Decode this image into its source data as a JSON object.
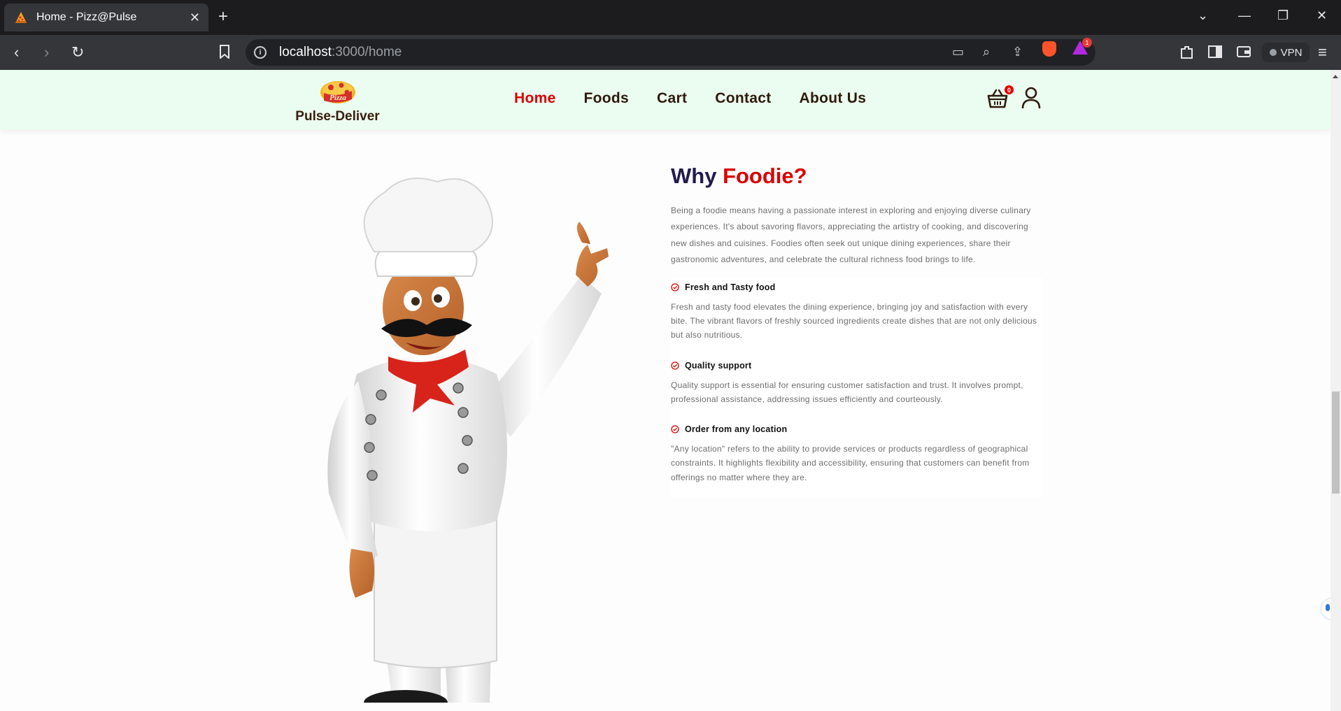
{
  "browser": {
    "tab_title": "Home - Pizz@Pulse",
    "url_host": "localhost",
    "url_path": ":3000/home",
    "vpn_label": "VPN",
    "brave_rewards_badge": "1",
    "icons": [
      "back-icon",
      "forward-icon",
      "reload-icon",
      "bookmark-icon",
      "info-icon",
      "cast-icon",
      "zoom-icon",
      "share-icon",
      "brave-shields-icon",
      "brave-rewards-icon",
      "extensions-icon",
      "sidebar-icon",
      "wallet-icon",
      "menu-icon"
    ]
  },
  "navbar": {
    "logo_text": "Pulse-Deliver",
    "links": [
      {
        "label": "Home",
        "active": true
      },
      {
        "label": "Foods",
        "active": false
      },
      {
        "label": "Cart",
        "active": false
      },
      {
        "label": "Contact",
        "active": false
      },
      {
        "label": "About Us",
        "active": false
      }
    ],
    "cart_count": "0"
  },
  "section": {
    "heading_prefix": "Why",
    "heading_accent": "Foodie?",
    "intro": "Being a foodie means having a passionate interest in exploring and enjoying diverse culinary experiences. It's about savoring flavors, appreciating the artistry of cooking, and discovering new dishes and cuisines. Foodies often seek out unique dining experiences, share their gastronomic adventures, and celebrate the cultural richness food brings to life.",
    "features": [
      {
        "title": "Fresh and Tasty food",
        "description": "Fresh and tasty food elevates the dining experience, bringing joy and satisfaction with every bite. The vibrant flavors of freshly sourced ingredients create dishes that are not only delicious but also nutritious."
      },
      {
        "title": "Quality support",
        "description": "Quality support is essential for ensuring customer satisfaction and trust. It involves prompt, professional assistance, addressing issues efficiently and courteously."
      },
      {
        "title": "Order from any location",
        "description": "\"Any location\" refers to the ability to provide services or products regardless of geographical constraints. It highlights flexibility and accessibility, ensuring that customers can benefit from offerings no matter where they are."
      }
    ]
  },
  "colors": {
    "accent": "#d90000",
    "heading": "#221b4d",
    "navbar_bg": "#ebfdf0",
    "body_text": "#6d6d6d"
  }
}
